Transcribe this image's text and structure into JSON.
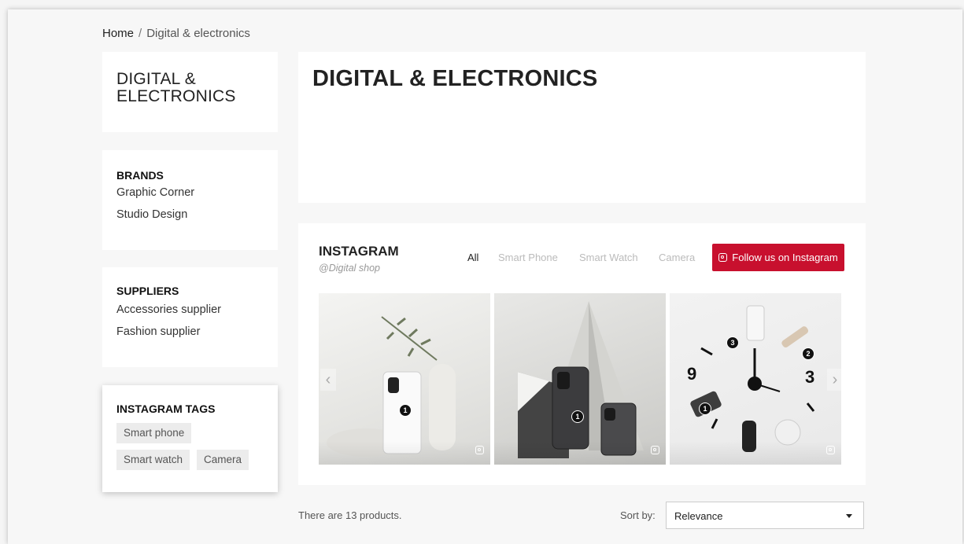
{
  "breadcrumb": {
    "home": "Home",
    "separator": "/",
    "current": "Digital & electronics"
  },
  "sidebar": {
    "category_title": "DIGITAL & ELECTRONICS",
    "brands": {
      "heading": "BRANDS",
      "items": [
        "Graphic Corner",
        "Studio Design"
      ]
    },
    "suppliers": {
      "heading": "SUPPLIERS",
      "items": [
        "Accessories supplier",
        "Fashion supplier"
      ]
    },
    "instagram_tags": {
      "heading": "INSTAGRAM TAGS",
      "tags": [
        "Smart phone",
        "Smart watch",
        "Camera"
      ]
    }
  },
  "main": {
    "title": "DIGITAL & ELECTRONICS",
    "instagram": {
      "title": "INSTAGRAM",
      "handle": "@Digital shop",
      "filters": [
        "All",
        "Smart Phone",
        "Smart Watch",
        "Camera"
      ],
      "active_filter": "All",
      "follow_label": "Follow us on Instagram",
      "accent_color": "#c8102e",
      "photos": [
        {
          "markers": [
            "1"
          ]
        },
        {
          "markers": [
            "1"
          ]
        },
        {
          "markers": [
            "3",
            "2",
            "1"
          ]
        }
      ],
      "nav": {
        "prev": "‹",
        "next": "›"
      }
    },
    "listing": {
      "count_text": "There are 13 products.",
      "sort_label": "Sort by:",
      "sort_value": "Relevance"
    }
  }
}
